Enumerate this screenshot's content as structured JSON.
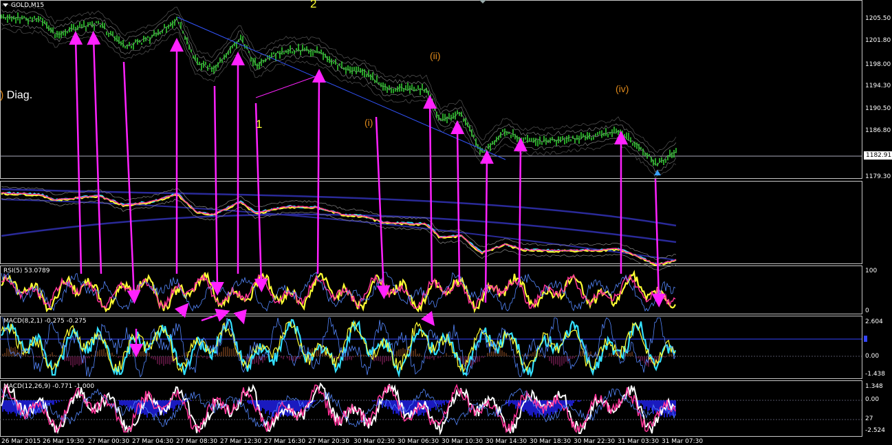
{
  "window": {
    "symbol": "GOLD,M15"
  },
  "annotations": {
    "diag_label": "Diag.",
    "wave_1": "1",
    "wave_2": "2",
    "wave_i": "(i)",
    "wave_ii": "(ii)",
    "wave_iv": "(iv)"
  },
  "main_pane": {
    "price_ticks": [
      "1205.50",
      "1201.80",
      "1198.00",
      "1194.30",
      "1190.50",
      "1186.80",
      "1179.30"
    ],
    "current_price": "1182.91"
  },
  "rsi_pane": {
    "label": "RSI(5) 53.0789",
    "ticks": [
      "100",
      "0"
    ]
  },
  "macd1_pane": {
    "label": "MACD(8,2,1) -0.275 -0.275",
    "ticks": [
      "2.604",
      "0.00",
      "-1.438"
    ]
  },
  "macd2_pane": {
    "label": "MACD(12,26,9) -0.771 -1.000",
    "ticks": [
      "1.348",
      "0.00",
      "27",
      "-2.524"
    ]
  },
  "time_axis": [
    "26 Mar 2015",
    "26 Mar 19:30",
    "27 Mar 00:30",
    "27 Mar 04:30",
    "27 Mar 08:30",
    "27 Mar 12:30",
    "27 Mar 16:30",
    "27 Mar 20:30",
    "30 Mar 02:30",
    "30 Mar 06:30",
    "30 Mar 10:30",
    "30 Mar 14:30",
    "30 Mar 18:30",
    "30 Mar 22:30",
    "31 Mar 03:30",
    "31 Mar 07:30"
  ],
  "colors": {
    "background": "#000000",
    "candles": "#33cc33",
    "arrows": "#ff22ff",
    "trendline": "#3355ff",
    "rsi": "#ffff33",
    "cyan_line": "#33e0ff",
    "histogram": "#2222ff",
    "wave_yellow": "#ffff33",
    "wave_orange": "#e08a1c"
  }
}
